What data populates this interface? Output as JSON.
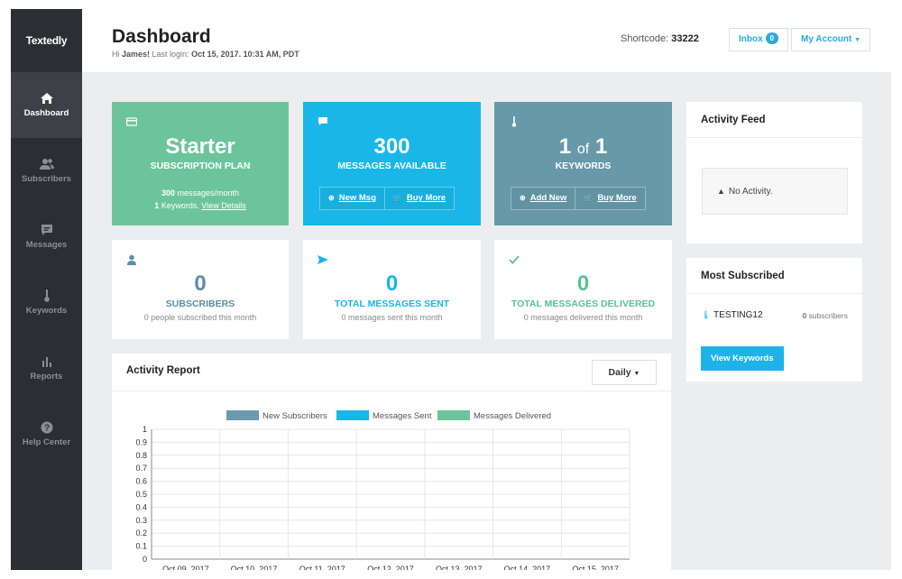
{
  "sidebar": {
    "logo": "Textedly",
    "items": [
      {
        "label": "Dashboard",
        "icon": "home-icon",
        "active": true
      },
      {
        "label": "Subscribers",
        "icon": "users-icon",
        "active": false
      },
      {
        "label": "Messages",
        "icon": "message-icon",
        "active": false
      },
      {
        "label": "Keywords",
        "icon": "thermometer-icon",
        "active": false
      },
      {
        "label": "Reports",
        "icon": "bar-chart-icon",
        "active": false
      },
      {
        "label": "Help Center",
        "icon": "help-icon",
        "active": false
      }
    ]
  },
  "header": {
    "title": "Dashboard",
    "greeting_prefix": "Hi ",
    "user_name": "James!",
    "last_login_label": " Last login: ",
    "last_login_value": "Oct 15, 2017. 10:31 AM, PDT",
    "shortcode_label": "Shortcode: ",
    "shortcode_value": "33222",
    "inbox_label": "Inbox",
    "inbox_count": "0",
    "account_label": "My Account"
  },
  "tiles": {
    "plan": {
      "title": "Starter",
      "subtitle": "SUBSCRIPTION PLAN",
      "messages_count": "300",
      "messages_text": " messages/month",
      "keywords_count": "1",
      "keywords_text": " Keywords. ",
      "details_link": "View Details",
      "color": "#6cc59a",
      "icon": "credit-card-icon"
    },
    "messages": {
      "title": "300",
      "subtitle": "MESSAGES AVAILABLE",
      "btn_new": "New Msg",
      "btn_buy": "Buy More",
      "color": "#1ab6e8",
      "icon": "chat-icon"
    },
    "keywords": {
      "count_used": "1",
      "of": "of",
      "count_total": "1",
      "subtitle": "KEYWORDS",
      "btn_add": "Add New",
      "btn_buy": "Buy More",
      "color": "#6799a8",
      "icon": "thermometer-icon"
    }
  },
  "cards": {
    "subscribers": {
      "value": "0",
      "label": "SUBSCRIBERS",
      "desc": "0 people subscribed this month",
      "color": "#5b8ea2"
    },
    "sent": {
      "value": "0",
      "label": "TOTAL MESSAGES SENT",
      "desc": "0 messages sent this month",
      "color": "#1ab6e8"
    },
    "delivered": {
      "value": "0",
      "label": "TOTAL MESSAGES DELIVERED",
      "desc": "0 messages delivered this month",
      "color": "#5cc193"
    }
  },
  "activity_feed": {
    "title": "Activity Feed",
    "empty_text": "No Activity."
  },
  "most_subscribed": {
    "title": "Most Subscribed",
    "keyword": "TESTING12",
    "count": "0 subscribers",
    "button": "View Keywords"
  },
  "report": {
    "title": "Activity Report",
    "period": "Daily"
  },
  "chart_data": {
    "type": "bar",
    "legend_position": "top",
    "series": [
      {
        "name": "New Subscribers",
        "color": "#6b9aac",
        "values": [
          0,
          0,
          0,
          0,
          0,
          0,
          0
        ]
      },
      {
        "name": "Messages Sent",
        "color": "#1ab6e8",
        "values": [
          0,
          0,
          0,
          0,
          0,
          0,
          0
        ]
      },
      {
        "name": "Messages Delivered",
        "color": "#6cc59a",
        "values": [
          0,
          0,
          0,
          0,
          0,
          0,
          0
        ]
      }
    ],
    "categories": [
      "Oct 09, 2017",
      "Oct 10, 2017",
      "Oct 11, 2017",
      "Oct 12, 2017",
      "Oct 13, 2017",
      "Oct 14, 2017",
      "Oct 15, 2017"
    ],
    "y_ticks": [
      "1",
      "0.9",
      "0.8",
      "0.7",
      "0.6",
      "0.5",
      "0.4",
      "0.3",
      "0.2",
      "0.1",
      "0"
    ],
    "ylim": [
      0,
      1
    ],
    "grid": true
  }
}
